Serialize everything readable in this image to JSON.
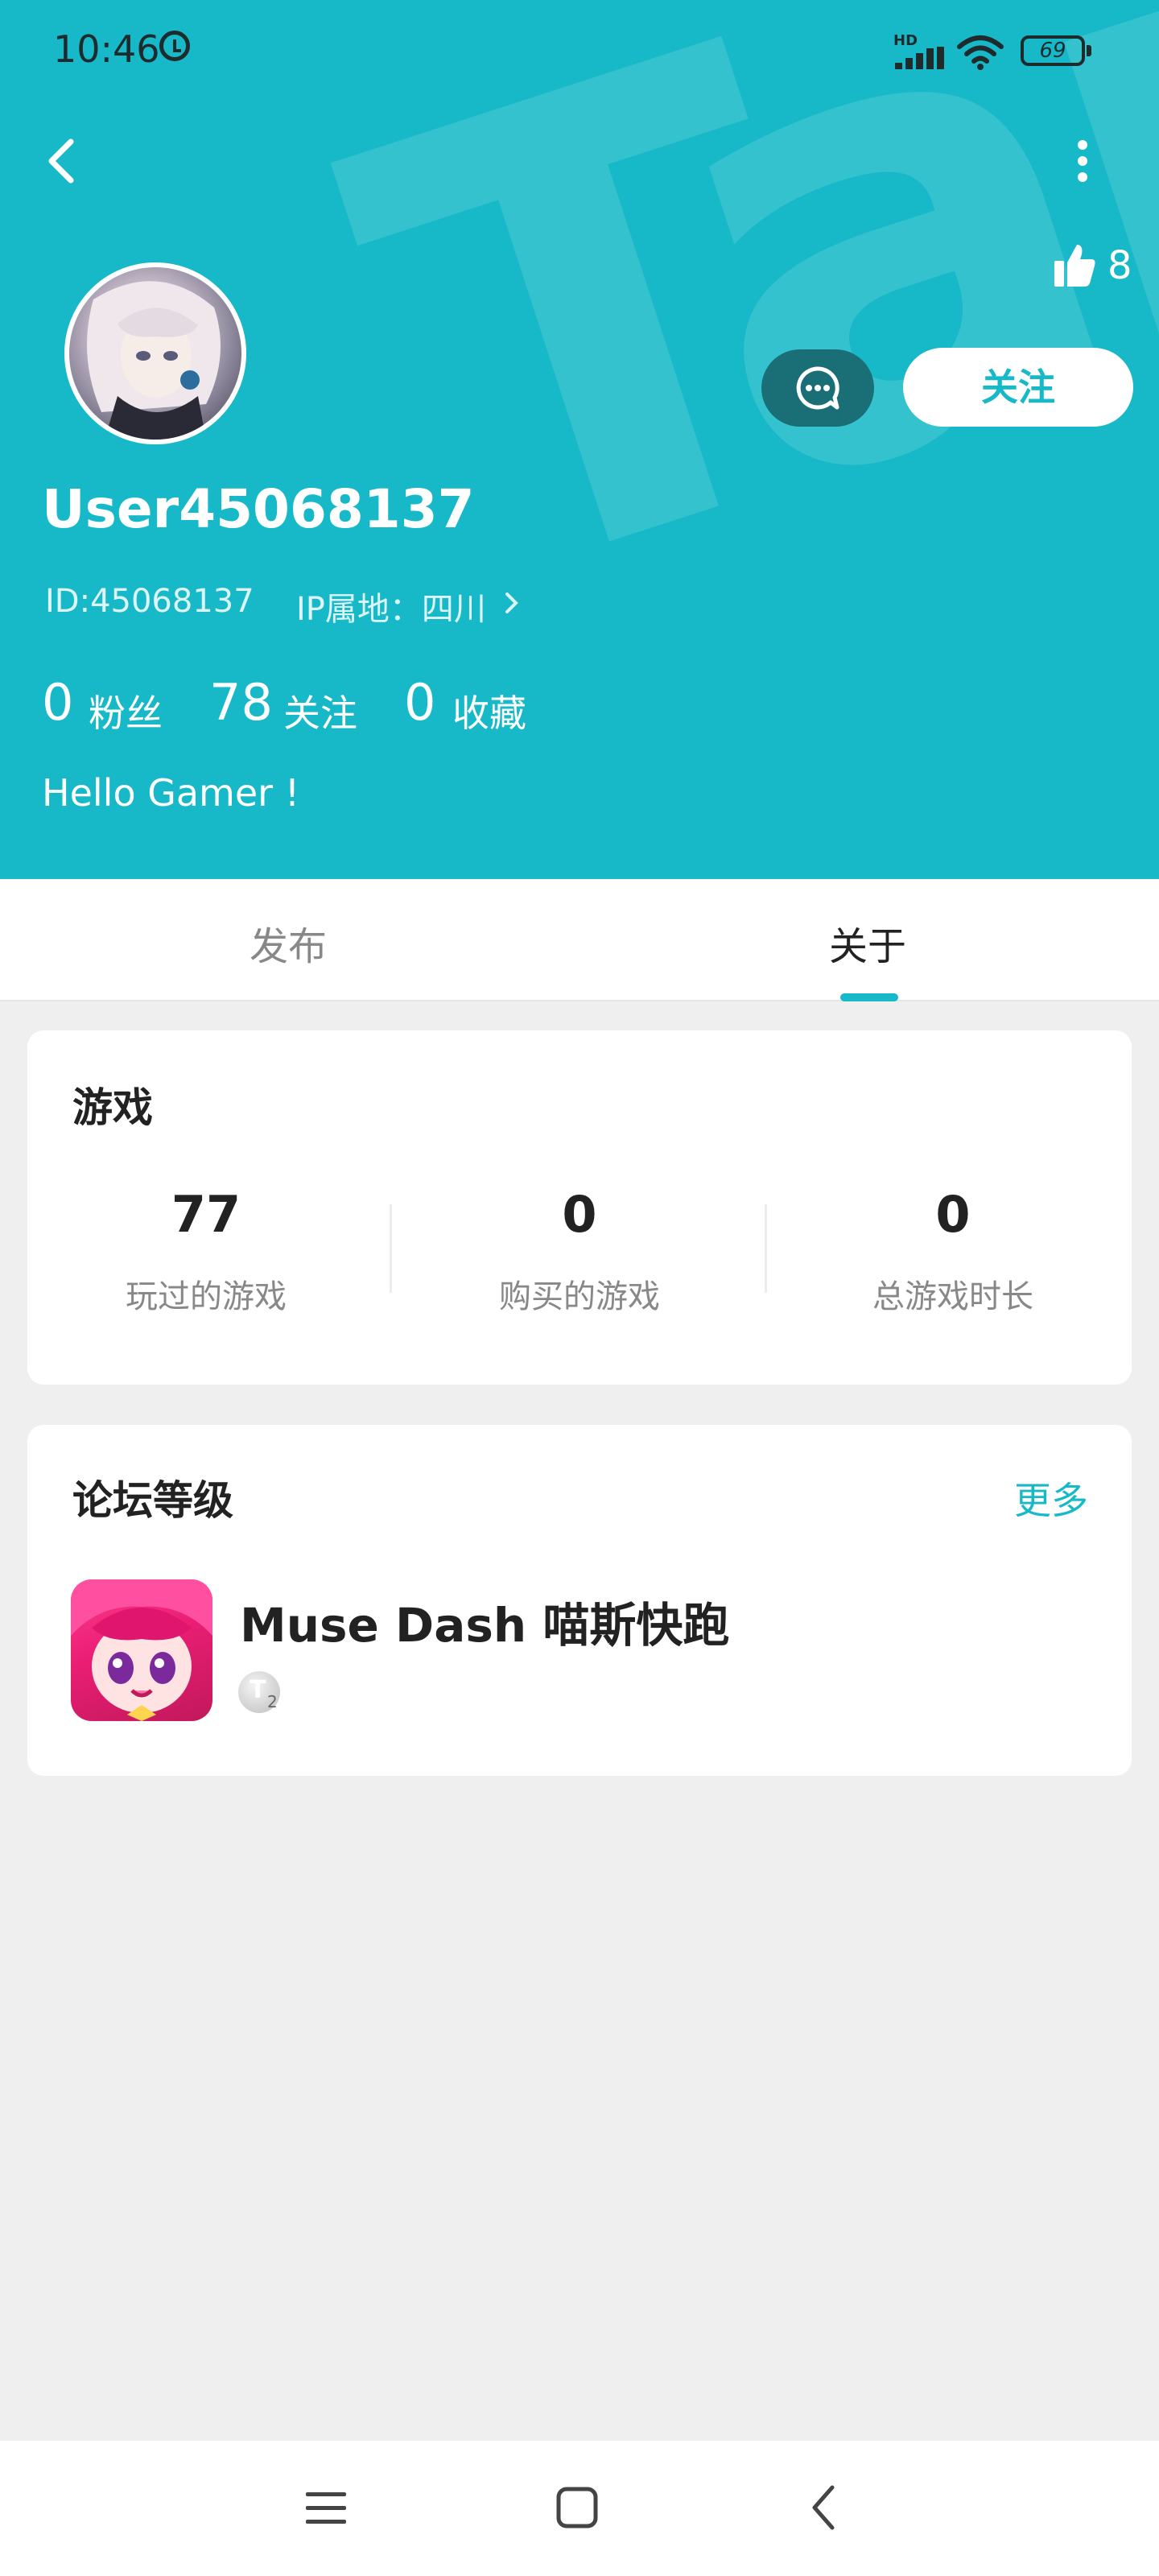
{
  "status_bar": {
    "time": "10:46",
    "network_badge": "HD",
    "battery": "69"
  },
  "profile": {
    "watermark": "TapTap",
    "likes": "8",
    "username": "User45068137",
    "id": "ID:45068137",
    "ip_location": "IP属地：四川",
    "follow_label": "关注",
    "stats": [
      {
        "value": "0",
        "label": "粉丝"
      },
      {
        "value": "78",
        "label": "关注"
      },
      {
        "value": "0",
        "label": "收藏"
      }
    ],
    "bio": "Hello Gamer !"
  },
  "tabs": [
    {
      "label": "发布",
      "active": false
    },
    {
      "label": "关于",
      "active": true
    }
  ],
  "games_card": {
    "title": "游戏",
    "stats": [
      {
        "value": "77",
        "label": "玩过的游戏"
      },
      {
        "value": "0",
        "label": "购买的游戏"
      },
      {
        "value": "0",
        "label": "总游戏时长"
      }
    ]
  },
  "forum_card": {
    "title": "论坛等级",
    "more_label": "更多",
    "game_name": "Muse Dash 喵斯快跑",
    "level_badge": "T",
    "level_number": "2"
  },
  "icons": {
    "back": "back-arrow-icon",
    "more": "more-vertical-icon",
    "like": "thumbs-up-icon",
    "message": "chat-bubble-icon"
  },
  "colors": {
    "primary": "#17b9c8",
    "message_button": "#1a6f77",
    "background": "#efefef"
  }
}
